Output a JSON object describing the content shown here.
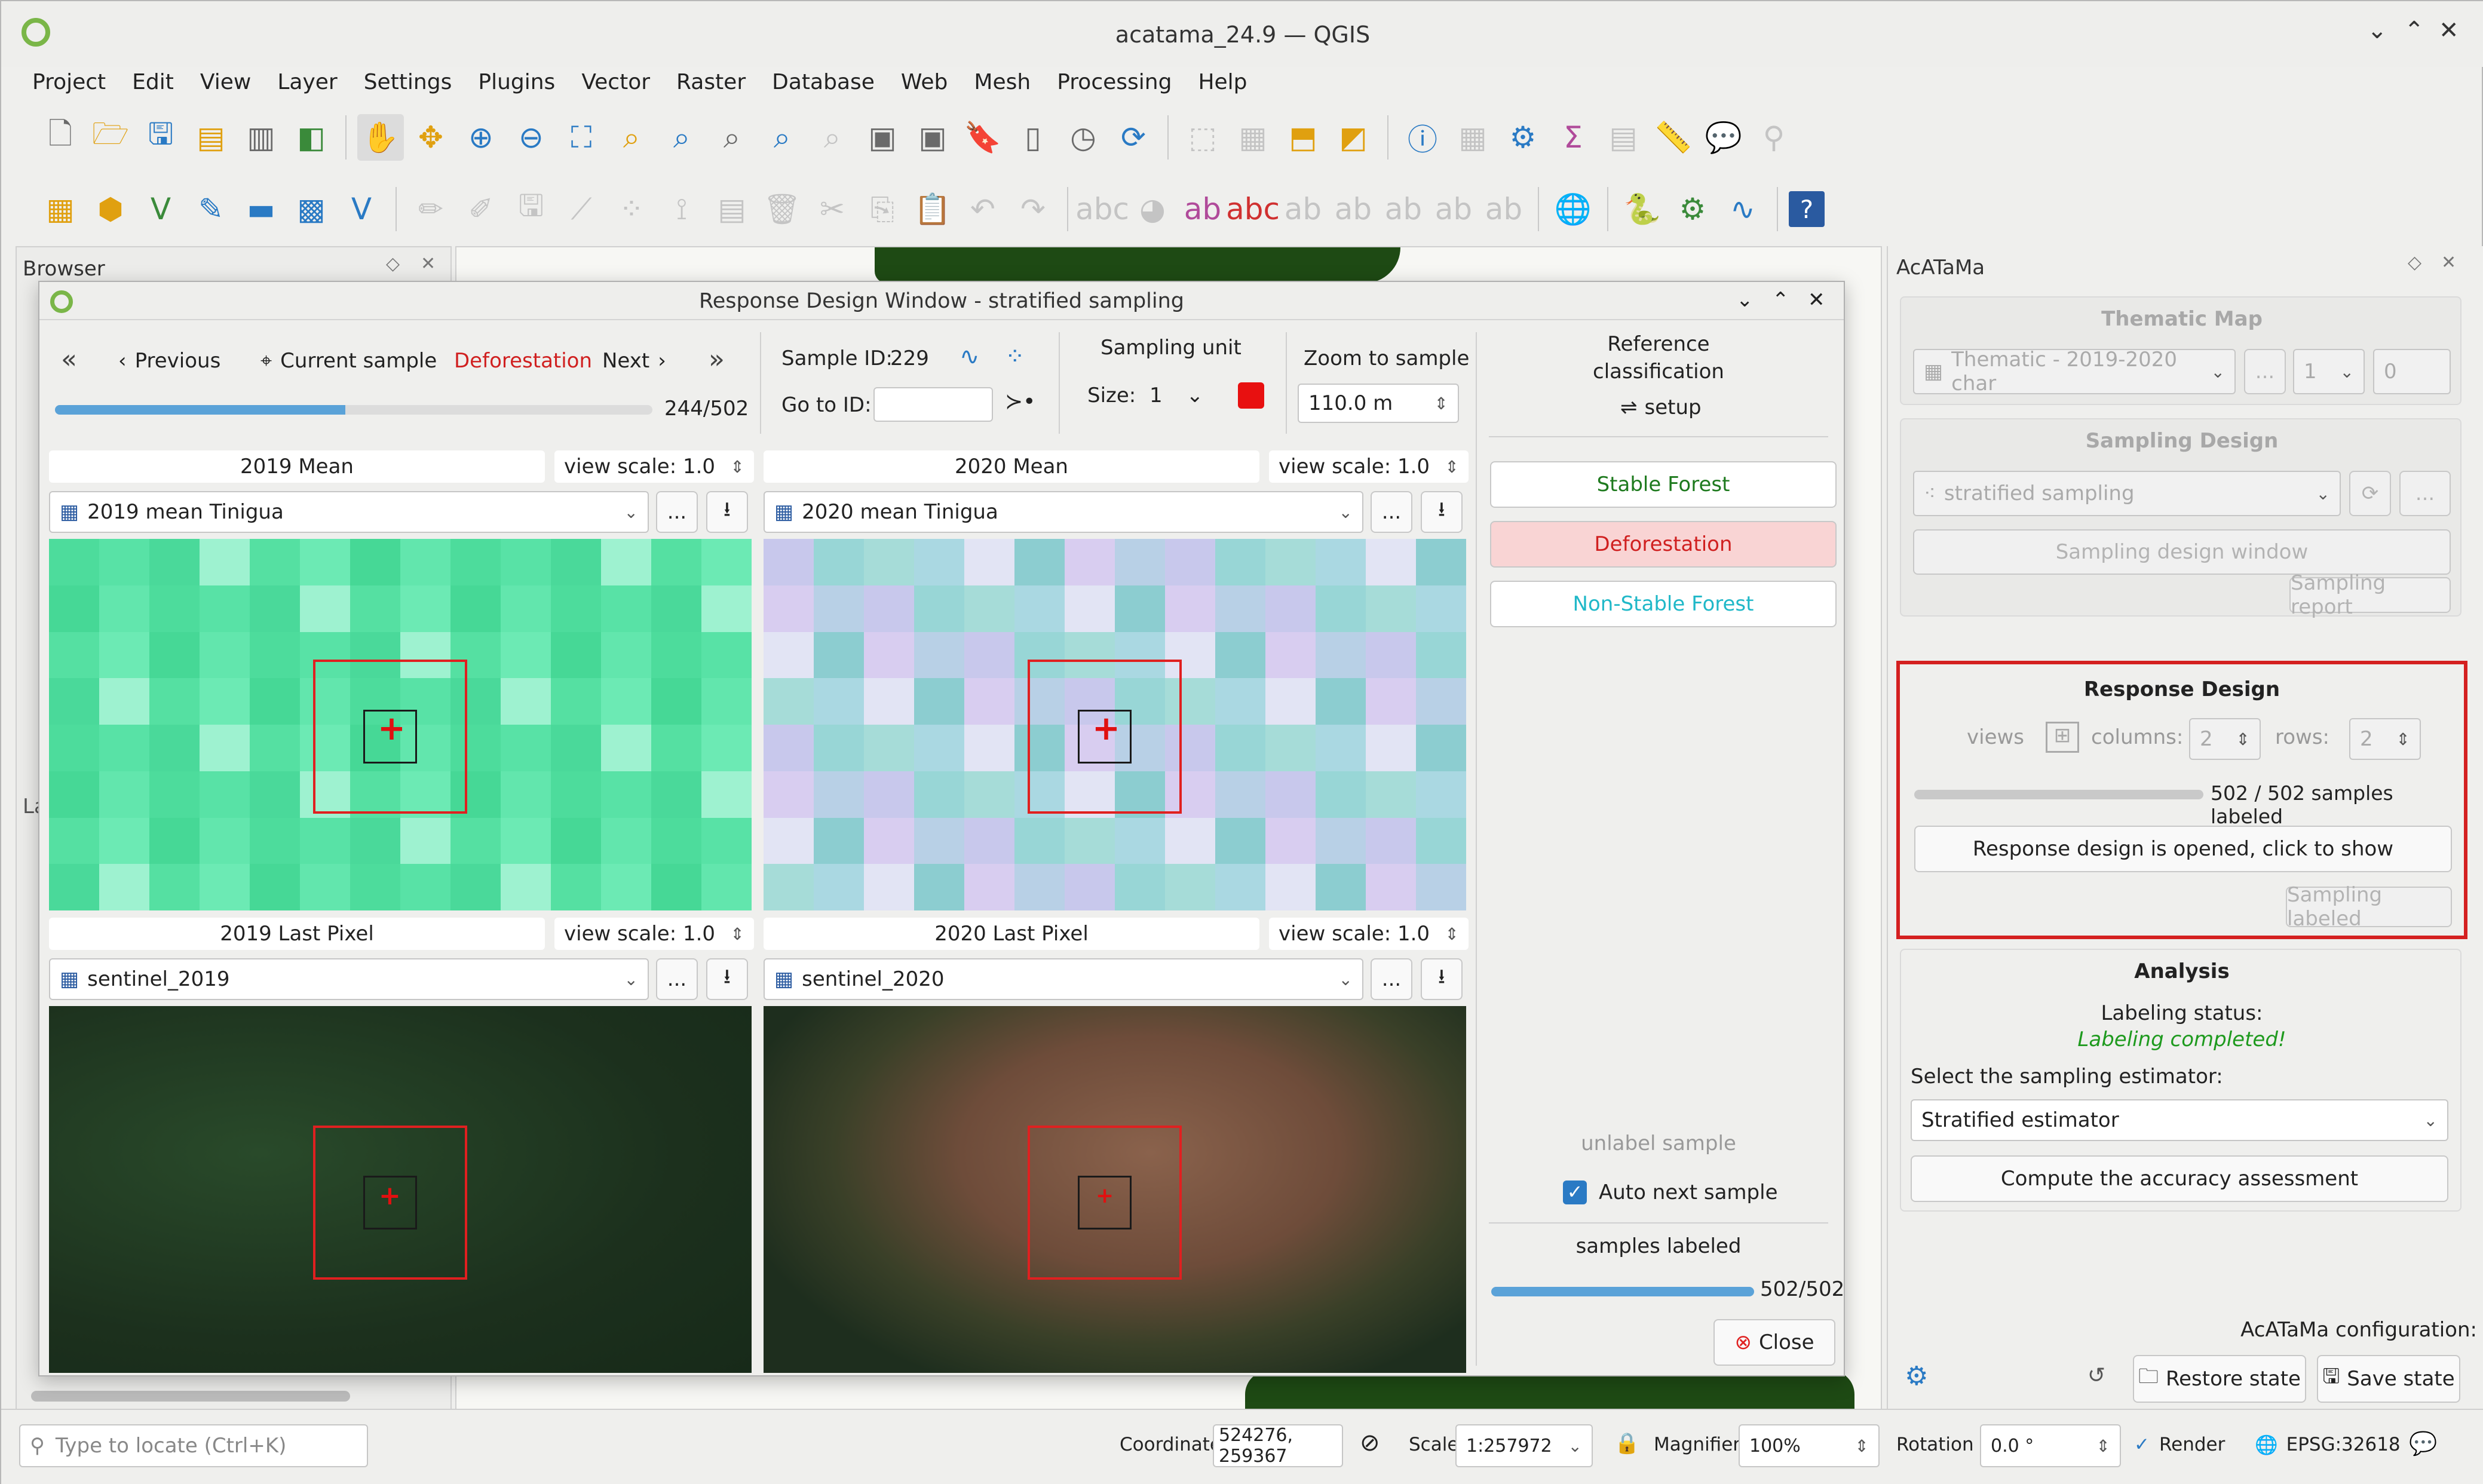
{
  "app": {
    "title": "acatama_24.9 — QGIS"
  },
  "menu": [
    "Project",
    "Edit",
    "View",
    "Layer",
    "Settings",
    "Plugins",
    "Vector",
    "Raster",
    "Database",
    "Web",
    "Mesh",
    "Processing",
    "Help"
  ],
  "browser": {
    "title": "Browser",
    "layers_abbr": "La"
  },
  "dialog": {
    "title": "Response Design Window - stratified sampling",
    "nav": {
      "first": "«",
      "previous": "Previous",
      "current": "Current sample",
      "class_label": "Deforestation",
      "next": "Next",
      "last": "»",
      "progress_text": "244/502",
      "progress": 0.486
    },
    "sample_id_label": "Sample ID:",
    "sample_id": "229",
    "goto_label": "Go to ID:",
    "goto_value": "",
    "sampling_unit": {
      "label": "Sampling unit",
      "size_label": "Size:",
      "size": "1",
      "color": "#e81010"
    },
    "zoom": {
      "label": "Zoom to sample",
      "value": "110.0 m"
    },
    "views": [
      {
        "title": "2019 Mean",
        "scale": "view scale: 1.0",
        "layer": "2019 mean Tinigua"
      },
      {
        "title": "2020 Mean",
        "scale": "view scale: 1.0",
        "layer": "2020 mean Tinigua"
      },
      {
        "title": "2019 Last Pixel",
        "scale": "view scale: 1.0",
        "layer": "sentinel_2019"
      },
      {
        "title": "2020 Last Pixel",
        "scale": "view scale: 1.0",
        "layer": "sentinel_2020"
      }
    ],
    "dots": "...",
    "reference": {
      "title_line1": "Reference",
      "title_line2": "classification",
      "setup": "setup",
      "classes": [
        {
          "label": "Stable Forest",
          "color": "#1e7a1e",
          "bg": "#ffffff"
        },
        {
          "label": "Deforestation",
          "color": "#d02020",
          "bg": "#f9d4d4"
        },
        {
          "label": "Non-Stable Forest",
          "color": "#20b8c8",
          "bg": "#ffffff"
        }
      ],
      "unlabel": "unlabel sample",
      "auto_next": "Auto next sample",
      "auto_next_checked": true,
      "samples_labeled": "samples labeled",
      "labeled_text": "502/502",
      "labeled_progress": 1.0,
      "close": "Close"
    }
  },
  "acatama": {
    "title": "AcATaMa",
    "thematic": {
      "title": "Thematic Map",
      "layer": "Thematic - 2019-2020 char",
      "band": "1",
      "nodata": "0",
      "dots": "..."
    },
    "sampling": {
      "title": "Sampling Design",
      "layer": "stratified sampling",
      "window": "Sampling design window",
      "report": "Sampling report",
      "dots": "..."
    },
    "response": {
      "title": "Response Design",
      "views": "views",
      "columns_label": "columns:",
      "columns": "2",
      "rows_label": "rows:",
      "rows": "2",
      "labeled_text": "502 / 502 samples labeled",
      "open_btn": "Response design is opened, click to show",
      "labeled_btn": "Sampling labeled"
    },
    "analysis": {
      "title": "Analysis",
      "status_label": "Labeling status:",
      "status": "Labeling completed!",
      "estimator_label": "Select the sampling estimator:",
      "estimator": "Stratified estimator",
      "compute": "Compute the accuracy assessment"
    },
    "config": {
      "label": "AcATaMa configuration:",
      "restore": "Restore state",
      "save": "Save state"
    }
  },
  "statusbar": {
    "locate_placeholder": "Type to locate (Ctrl+K)",
    "coord_label": "Coordinate",
    "coord": "524276, 259367",
    "scale_label": "Scale",
    "scale": "1:257972",
    "magnifier_label": "Magnifier",
    "magnifier": "100%",
    "rotation_label": "Rotation",
    "rotation": "0.0 °",
    "render": "Render",
    "crs": "EPSG:32618"
  }
}
